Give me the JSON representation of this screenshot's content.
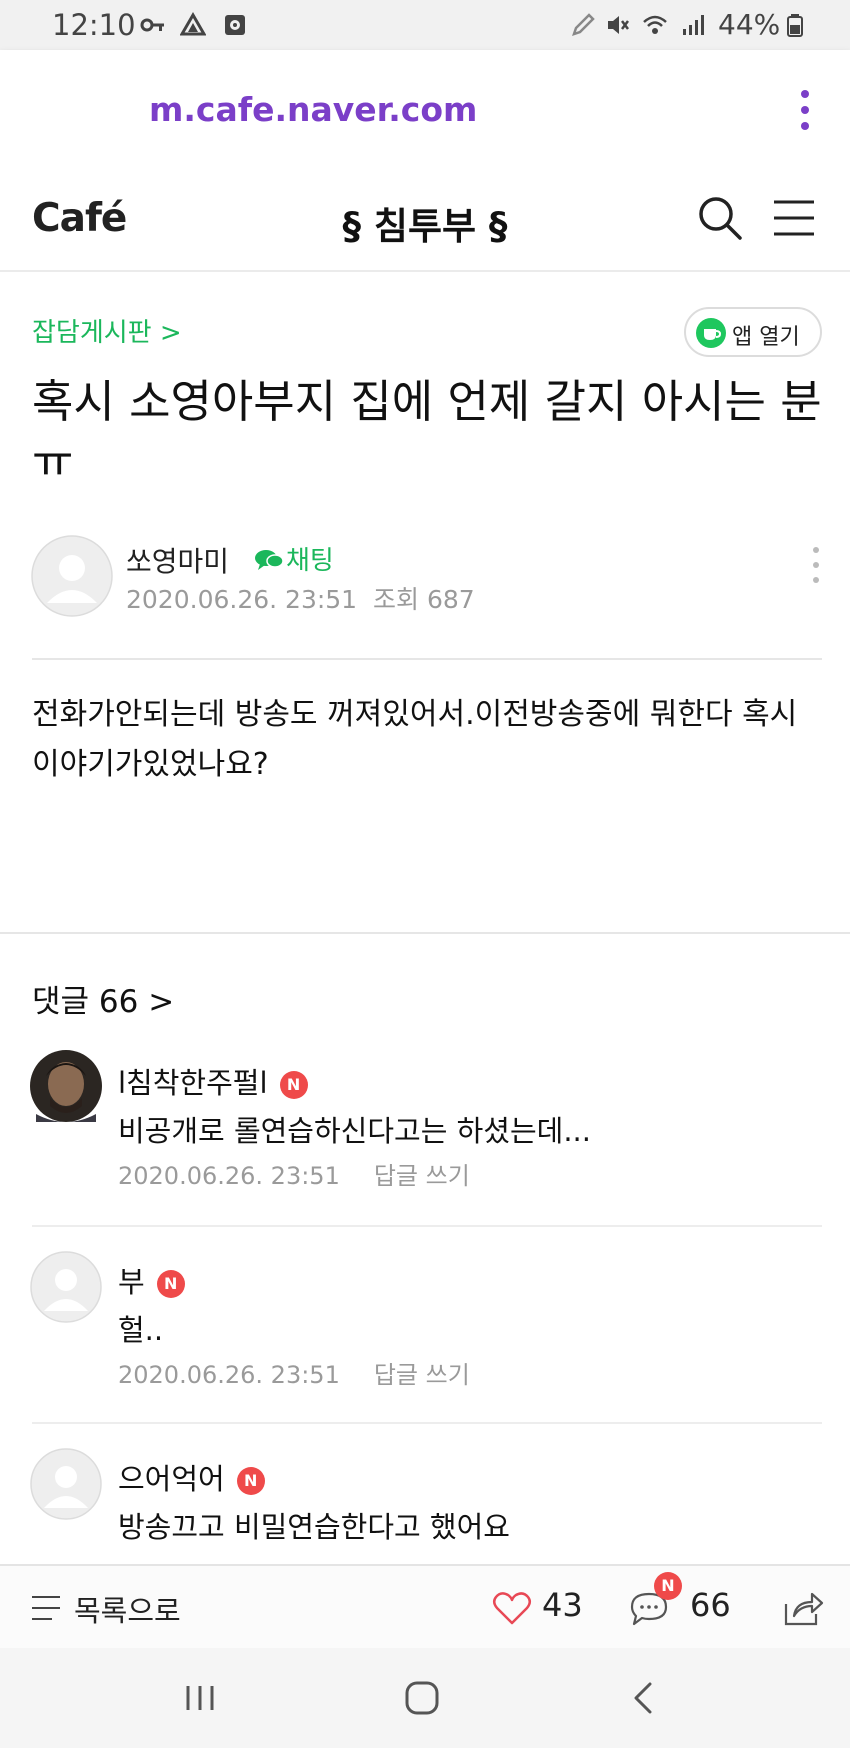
{
  "status_bar": {
    "time": "12:10",
    "battery": "44%"
  },
  "browser": {
    "url": "m.cafe.naver.com"
  },
  "header": {
    "logo": "Café",
    "cafe_name": "§ 침투부 §"
  },
  "board": {
    "name": "잡담게시판 >",
    "app_open": "앱 열기"
  },
  "post": {
    "title": "혹시 소영아부지 집에 언제 갈지 아시는 분 ㅠ",
    "author": "쏘영마미",
    "chat_label": "채팅",
    "date": "2020.06.26. 23:51",
    "views": "조회 687",
    "body": "전화가안되는데 방송도 꺼져있어서.이전방송중에 뭐한다 혹시 이야기가있었나요?"
  },
  "comments": {
    "header": "댓글 66 >",
    "new_badge": "N",
    "reply_label": "답글 쓰기",
    "items": [
      {
        "name": "l침착한주펄l",
        "text": "비공개로 롤연습하신다고는 하셨는데...",
        "date": "2020.06.26. 23:51"
      },
      {
        "name": "부",
        "text": "헐..",
        "date": "2020.06.26. 23:51"
      },
      {
        "name": "으어억어",
        "text": "방송끄고 비밀연습한다고 했어요",
        "date": ""
      }
    ]
  },
  "bottom_bar": {
    "list_label": "목록으로",
    "likes": "43",
    "comments": "66",
    "new_badge": "N"
  },
  "colors": {
    "url": "#7b3fc8",
    "accent_green": "#1bb75b",
    "new_badge": "#ef4a4a"
  }
}
